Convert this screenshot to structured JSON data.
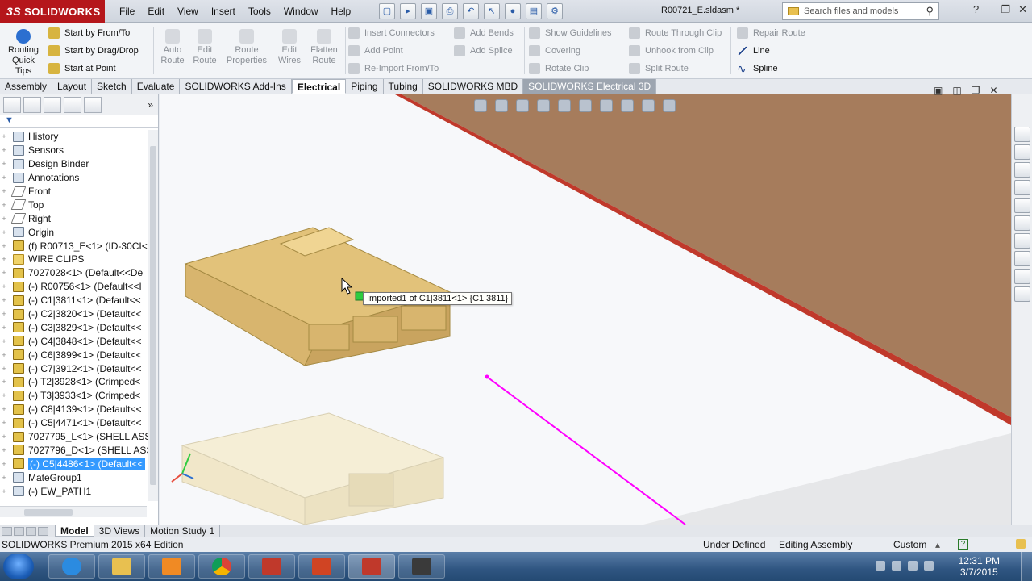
{
  "app": {
    "brand": "SOLIDWORKS",
    "document_title": "R00721_E.sldasm *",
    "menu": [
      "File",
      "Edit",
      "View",
      "Insert",
      "Tools",
      "Window",
      "Help"
    ],
    "search_placeholder": "Search files and models"
  },
  "command_manager": {
    "routing_quick_tips": "Routing Quick Tips",
    "start_group": [
      "Start by From/To",
      "Start by Drag/Drop",
      "Start at Point"
    ],
    "big_buttons": [
      "Auto Route",
      "Edit Route",
      "Route Properties",
      "Edit Wires",
      "Flatten Route"
    ],
    "col_insert": [
      "Insert Connectors",
      "Add Point",
      "Re-Import From/To"
    ],
    "col_bends": [
      "Add Bends",
      "Add Splice"
    ],
    "col_guides": [
      "Show Guidelines",
      "Covering",
      "Rotate Clip"
    ],
    "col_clip": [
      "Route Through Clip",
      "Unhook from Clip",
      "Split Route"
    ],
    "col_repair": [
      "Repair Route",
      "Line",
      "Spline"
    ]
  },
  "tabs": [
    "Assembly",
    "Layout",
    "Sketch",
    "Evaluate",
    "SOLIDWORKS Add-Ins",
    "Electrical",
    "Piping",
    "Tubing",
    "SOLIDWORKS MBD",
    "SOLIDWORKS Electrical 3D"
  ],
  "active_tab": "Electrical",
  "feature_tree": [
    {
      "label": "History",
      "type": "misc"
    },
    {
      "label": "Sensors",
      "type": "misc"
    },
    {
      "label": "Design Binder",
      "type": "misc"
    },
    {
      "label": "Annotations",
      "type": "misc"
    },
    {
      "label": "Front",
      "type": "plane"
    },
    {
      "label": "Top",
      "type": "plane"
    },
    {
      "label": "Right",
      "type": "plane"
    },
    {
      "label": "Origin",
      "type": "misc"
    },
    {
      "label": "(f) R00713_E<1> (ID-30CI<",
      "type": "part"
    },
    {
      "label": "WIRE CLIPS",
      "type": "folder"
    },
    {
      "label": "7027028<1> (Default<<De",
      "type": "part"
    },
    {
      "label": "(-) R00756<1> (Default<<I",
      "type": "part"
    },
    {
      "label": "(-) C1|3811<1> (Default<<",
      "type": "part"
    },
    {
      "label": "(-) C2|3820<1> (Default<<",
      "type": "part"
    },
    {
      "label": "(-) C3|3829<1> (Default<<",
      "type": "part"
    },
    {
      "label": "(-) C4|3848<1> (Default<<",
      "type": "part"
    },
    {
      "label": "(-) C6|3899<1> (Default<<",
      "type": "part"
    },
    {
      "label": "(-) C7|3912<1> (Default<<",
      "type": "part"
    },
    {
      "label": "(-) T2|3928<1> (Crimped<",
      "type": "part"
    },
    {
      "label": "(-) T3|3933<1> (Crimped<",
      "type": "part"
    },
    {
      "label": "(-) C8|4139<1> (Default<<",
      "type": "part"
    },
    {
      "label": "(-) C5|4471<1> (Default<<",
      "type": "part"
    },
    {
      "label": "7027795_L<1> (SHELL ASS",
      "type": "part"
    },
    {
      "label": "7027796_D<1> (SHELL ASS",
      "type": "part"
    },
    {
      "label": "(-) C5|4486<1> (Default<<",
      "type": "part",
      "selected": true
    },
    {
      "label": "MateGroup1",
      "type": "misc"
    },
    {
      "label": "(-) EW_PATH1",
      "type": "misc"
    }
  ],
  "viewport": {
    "tooltip": "Imported1 of C1|3811<1> {C1|3811}",
    "colors": {
      "wall": "#a67c5c",
      "wall_edge": "#c0392b",
      "connector": "#e2c27a",
      "route": "#ff00ff"
    }
  },
  "bottom_tabs": [
    "Model",
    "3D Views",
    "Motion Study 1"
  ],
  "status": {
    "edition": "SOLIDWORKS Premium 2015 x64 Edition",
    "defined": "Under Defined",
    "editing": "Editing Assembly",
    "units": "Custom",
    "help": "?"
  },
  "taskbar": {
    "time": "12:31 PM",
    "date": "3/7/2015"
  }
}
